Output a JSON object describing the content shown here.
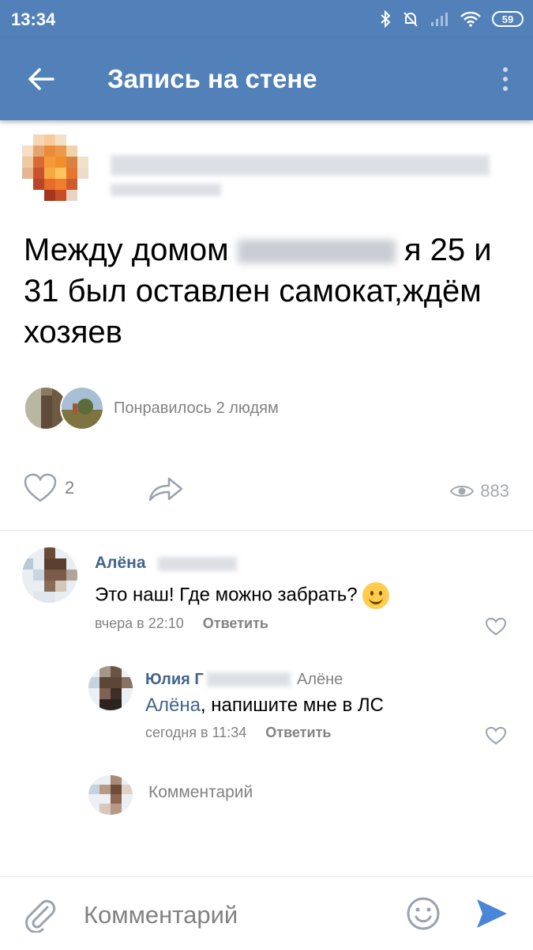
{
  "status": {
    "time": "13:34",
    "battery": "59"
  },
  "appbar": {
    "title": "Запись на стене"
  },
  "post": {
    "text_before": "Между домом",
    "text_after": "я 25 и 31 был оставлен самокат,ждём хозяев",
    "likes_text": "Понравилось 2 людям",
    "like_count": "2",
    "views": "883"
  },
  "comments": [
    {
      "author": "Алёна",
      "text": "Это наш! Где можно забрать?",
      "time": "вчера в 22:10",
      "reply_label": "Ответить"
    },
    {
      "author": "Юлия Г",
      "reply_to": "Алёне",
      "mention": "Алёна",
      "text": ", напишите мне в ЛС",
      "time": "сегодня в 11:34",
      "reply_label": "Ответить"
    }
  ],
  "inline_comment": {
    "placeholder": "Комментарий"
  },
  "composer": {
    "placeholder": "Комментарий"
  },
  "colors": {
    "header": "#5181b8",
    "link": "#42648b",
    "send": "#4a86d8"
  },
  "icons": [
    "bluetooth-icon",
    "bell-off-icon",
    "signal-icon",
    "wifi-icon",
    "battery-icon",
    "back-arrow-icon",
    "more-vertical-icon",
    "heart-icon",
    "share-icon",
    "eye-icon",
    "paperclip-icon",
    "smile-icon",
    "send-icon"
  ]
}
